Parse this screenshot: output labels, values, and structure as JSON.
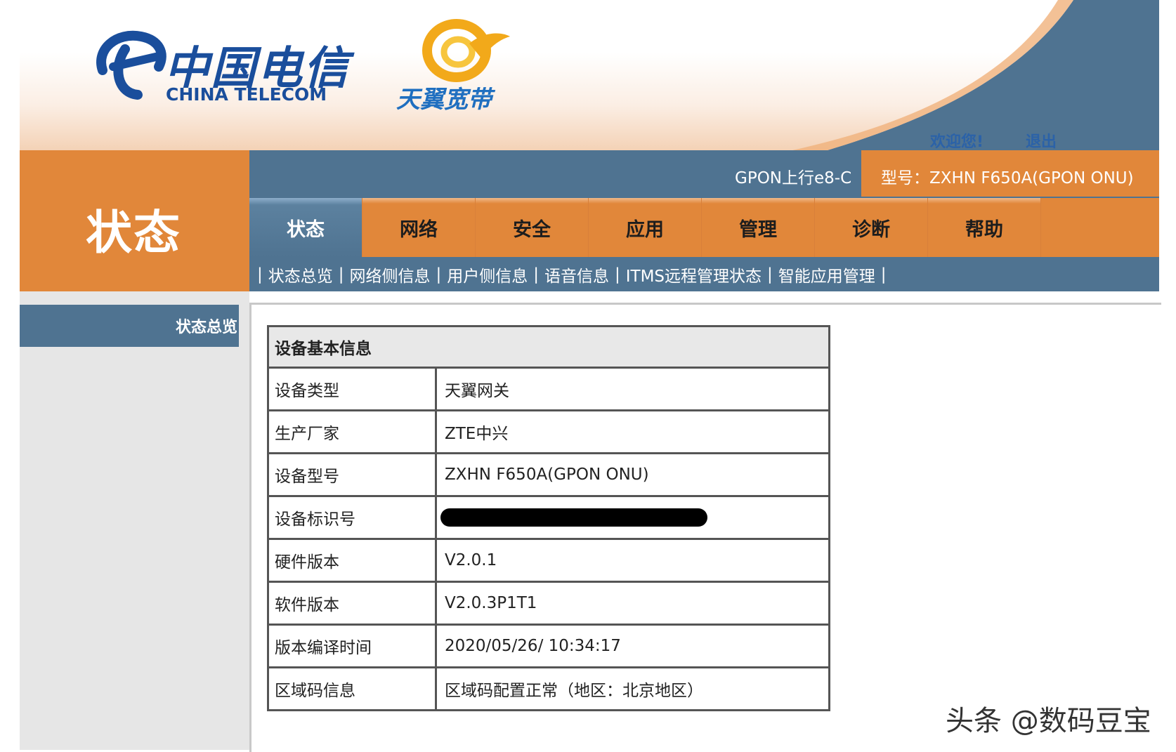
{
  "header": {
    "ct_logo_cn": "中国电信",
    "ct_logo_en": "CHINA TELECOM",
    "ty_logo": "天翼宽带",
    "welcome": "欢迎您!",
    "logout": "退出"
  },
  "title": "状态",
  "device_line": {
    "gpon": "GPON上行e8-C",
    "model": "型号：ZXHN F650A(GPON ONU)"
  },
  "tabs": [
    {
      "label": "状态",
      "active": true
    },
    {
      "label": "网络",
      "active": false
    },
    {
      "label": "安全",
      "active": false
    },
    {
      "label": "应用",
      "active": false
    },
    {
      "label": "管理",
      "active": false
    },
    {
      "label": "诊断",
      "active": false
    },
    {
      "label": "帮助",
      "active": false
    }
  ],
  "subnav": [
    "状态总览",
    "网络侧信息",
    "用户侧信息",
    "语音信息",
    "ITMS远程管理状态",
    "智能应用管理"
  ],
  "sidebar": {
    "item": "状态总览"
  },
  "table": {
    "title": "设备基本信息",
    "rows": [
      {
        "key": "设备类型",
        "value": "天翼网关"
      },
      {
        "key": "生产厂家",
        "value": "ZTE中兴"
      },
      {
        "key": "设备型号",
        "value": "ZXHN F650A(GPON ONU)"
      },
      {
        "key": "设备标识号",
        "value": ""
      },
      {
        "key": "硬件版本",
        "value": "V2.0.1"
      },
      {
        "key": "软件版本",
        "value": "V2.0.3P1T1"
      },
      {
        "key": "版本编译时间",
        "value": "2020/05/26/ 10:34:17"
      },
      {
        "key": "区域码信息",
        "value": "区域码配置正常（地区：北京地区）"
      }
    ]
  },
  "watermark": "头条 @数码豆宝",
  "colors": {
    "orange": "#e1873a",
    "steel_blue": "#4f7391",
    "brand_blue": "#1a4e9c"
  }
}
